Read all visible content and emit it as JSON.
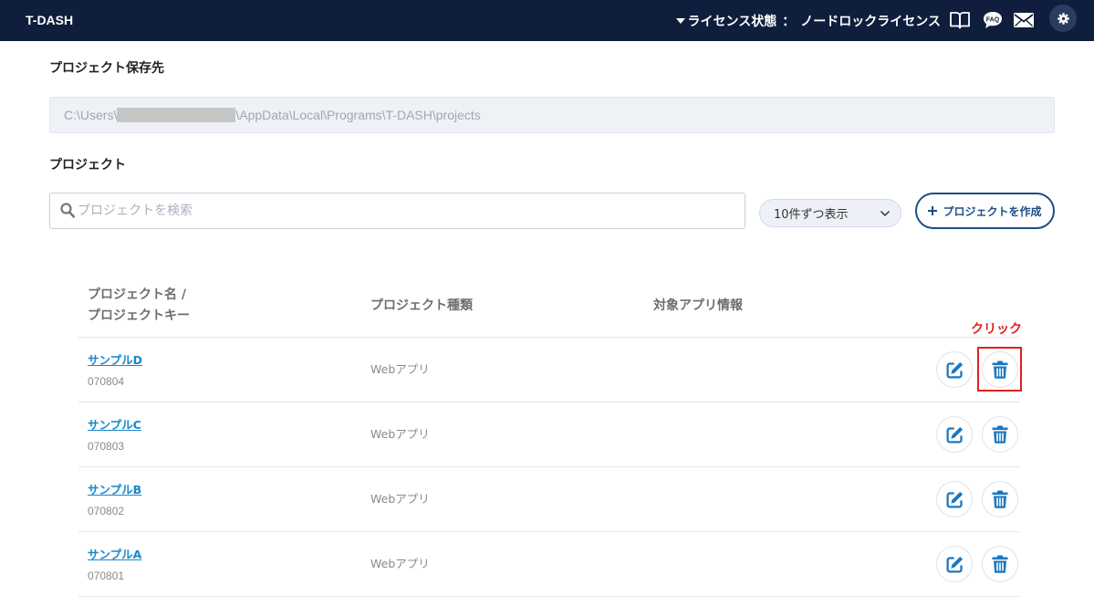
{
  "header": {
    "app_title": "T-DASH",
    "license_label": "ライセンス状態",
    "license_separator": "：",
    "license_value": "ノードロックライセンス",
    "faq_icon_text": "FAQ",
    "icons": [
      "caret-down-icon",
      "book-icon",
      "faq-icon",
      "mail-icon",
      "gear-icon"
    ]
  },
  "storage": {
    "title": "プロジェクト保存先",
    "path_prefix": "C:\\Users\\",
    "path_suffix": "\\AppData\\Local\\Programs\\T-DASH\\projects"
  },
  "projects": {
    "title": "プロジェクト",
    "search_placeholder": "プロジェクトを検索",
    "page_size_selected": "10件ずつ表示",
    "create_button": "プロジェクトを作成"
  },
  "table": {
    "headers": {
      "name_line1": "プロジェクト名 /",
      "name_line2": "プロジェクトキー",
      "type": "プロジェクト種類",
      "app_info": "対象アプリ情報"
    },
    "rows": [
      {
        "name": "サンプルD",
        "key": "070804",
        "type": "Webアプリ"
      },
      {
        "name": "サンプルC",
        "key": "070803",
        "type": "Webアプリ"
      },
      {
        "name": "サンプルB",
        "key": "070802",
        "type": "Webアプリ"
      },
      {
        "name": "サンプルA",
        "key": "070801",
        "type": "Webアプリ"
      }
    ],
    "row_action_icons": [
      "edit-icon",
      "trash-icon"
    ]
  },
  "annotation": {
    "label": "クリック"
  },
  "colors": {
    "header_bg": "#0f1e3c",
    "link": "#1888c9",
    "primary": "#1d4d85",
    "icon_blue": "#1b78c2",
    "annotation_red": "#e02020"
  }
}
